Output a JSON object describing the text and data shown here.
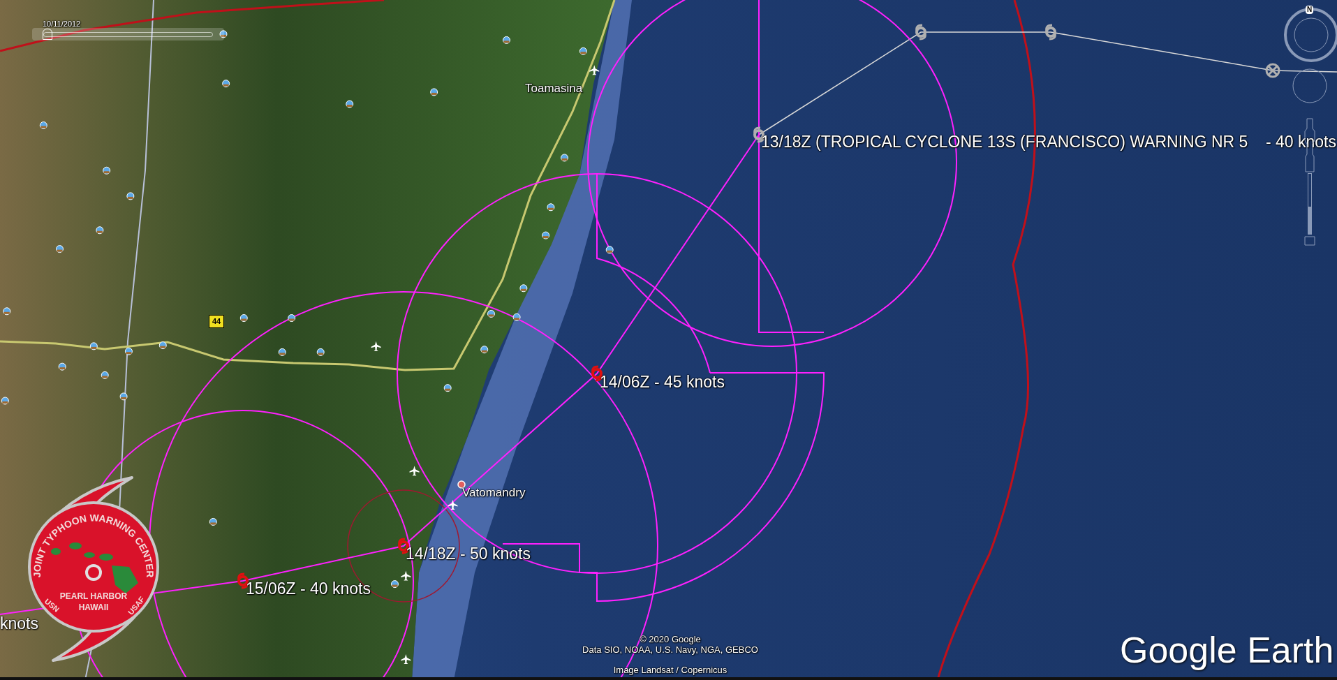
{
  "time_slider": {
    "date": "10/11/2012",
    "level": 0.02
  },
  "zoom_slider": {
    "level": 0.45
  },
  "places": [
    {
      "name": "Toamasina"
    },
    {
      "name": "Vatomandry"
    }
  ],
  "road_shield": "44",
  "track_labels": [
    {
      "label": "13/18Z (TROPICAL CYCLONE 13S (FRANCISCO) WARNING NR 5    - 40 knots"
    },
    {
      "label": "14/06Z - 45 knots"
    },
    {
      "label": "14/18Z - 50 knots"
    },
    {
      "label": "15/06Z - 40 knots"
    },
    {
      "label": "knots"
    }
  ],
  "emblem": {
    "arc_text": "JOINT TYPHOON WARNING CENTER",
    "line_1": "PEARL HARBOR",
    "line_2": "HAWAII",
    "left_text": "USN",
    "right_text": "USAF"
  },
  "compass": {
    "north": "N"
  },
  "attribution": [
    "© 2020 Google",
    "Data SIO, NOAA, U.S. Navy, NGA, GEBCO",
    "Image Landsat / Copernicus"
  ],
  "brand": "Google Earth"
}
